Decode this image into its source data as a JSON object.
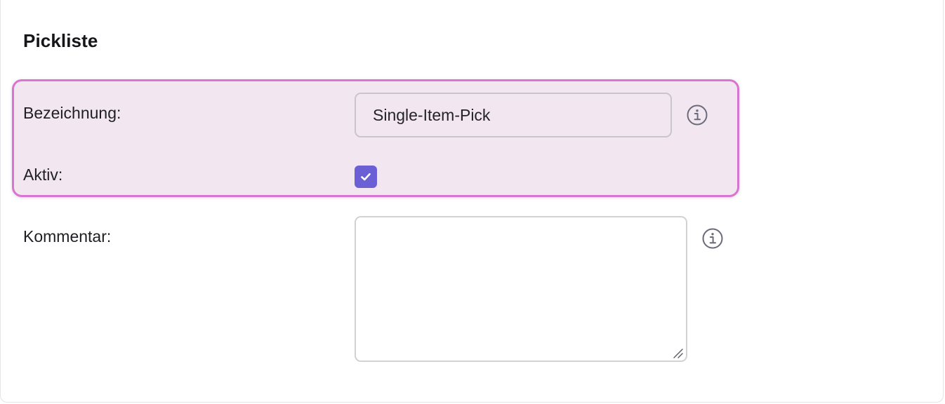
{
  "form": {
    "title": "Pickliste",
    "fields": {
      "name_label": "Bezeichnung:",
      "name_value": "Single-Item-Pick",
      "active_label": "Aktiv:",
      "active_checked": true,
      "comment_label": "Kommentar:",
      "comment_value": ""
    }
  },
  "colors": {
    "highlight_border": "#d775cf",
    "highlight_fill": "#f2e7f1",
    "checkbox_fill": "#6b5fd6",
    "icon_stroke": "#6a6a7a"
  },
  "icons": {
    "name_info": "info-icon",
    "comment_info": "info-icon",
    "checkmark": "check-icon",
    "resize": "resize-handle-icon"
  }
}
